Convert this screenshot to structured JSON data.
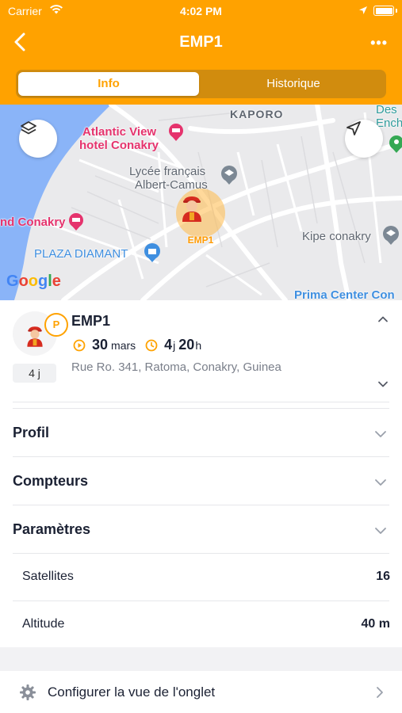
{
  "status": {
    "carrier": "Carrier",
    "time": "4:02 PM"
  },
  "nav": {
    "title": "EMP1",
    "back_icon": "chevron-left-icon",
    "more_label": "•••"
  },
  "tabs": [
    {
      "label": "Info",
      "active": true
    },
    {
      "label": "Historique",
      "active": false
    }
  ],
  "map": {
    "labels": {
      "kaporo": "KAPORO",
      "des": "Des",
      "ench": "Ench",
      "atlantic_1": "Atlantic View",
      "atlantic_2": "hotel Conakry",
      "lycee_1": "Lycée français",
      "lycee_2": "Albert-Camus",
      "conakry": "nd Conakry",
      "kipe": "Kipe conakry",
      "plaza": "PLAZA DIAMANT",
      "prima": "Prima Center Con",
      "google": "Google"
    },
    "marker_label": "EMP1",
    "colors": {
      "water": "#8ab4f8",
      "land": "#eaeaec",
      "road": "#ffffff",
      "poi_pink": "#e5336d",
      "poi_blue": "#3f8fe0",
      "poi_gray": "#7c8894"
    }
  },
  "device": {
    "name": "EMP1",
    "badge": "P",
    "days_badge": "4 j",
    "date_num": "30",
    "date_unit": "mars",
    "duration_num1": "4",
    "duration_unit1": "j",
    "duration_num2": "20",
    "duration_unit2": "h",
    "address": "Rue Ro. 341, Ratoma, Conakry, Guinea"
  },
  "sections": [
    {
      "label": "Profil"
    },
    {
      "label": "Compteurs"
    },
    {
      "label": "Paramètres"
    }
  ],
  "properties": [
    {
      "label": "Satellites",
      "value": "16"
    },
    {
      "label": "Altitude",
      "value": "40 m"
    }
  ],
  "footer": {
    "config_label": "Configurer la vue de l'onglet"
  },
  "colors": {
    "accent": "#ffa200",
    "segment_bg": "#d18c0e",
    "text": "#1b2133",
    "muted": "#7a7f8a"
  }
}
